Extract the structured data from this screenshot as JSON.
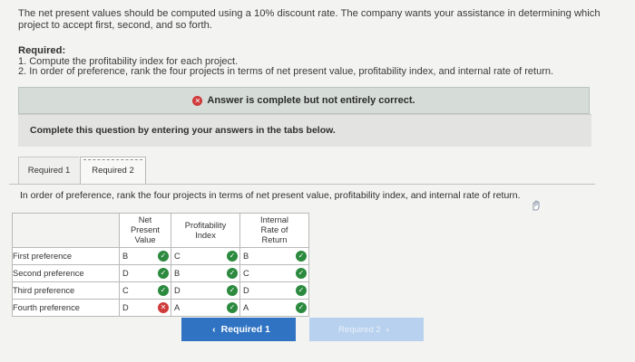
{
  "intro": {
    "line1": "The net present values should be computed using a 10% discount rate. The company wants your assistance in determining which",
    "line2": "project to accept first, second, and so forth."
  },
  "required": {
    "title": "Required:",
    "items": [
      "1. Compute the profitability index for each project.",
      "2. In order of preference, rank the four projects in terms of net present value, profitability index, and internal rate of return."
    ]
  },
  "answer_banner": {
    "status_icon": "x-circle-icon",
    "text": "Answer is complete but not entirely correct."
  },
  "instruction": "Complete this question by entering your answers in the tabs below.",
  "tabs": [
    {
      "label": "Required 1"
    },
    {
      "label": "Required 2"
    }
  ],
  "question": "In order of preference, rank the four projects in terms of net present value, profitability index, and internal rate of return.",
  "table": {
    "headers": {
      "npv": [
        "Net",
        "Present",
        "Value"
      ],
      "pi": [
        "Profitability",
        "Index"
      ],
      "irr": [
        "Internal",
        "Rate of",
        "Return"
      ]
    },
    "rows": [
      {
        "label": "First preference",
        "npv": "B",
        "npv_ok": true,
        "pi": "C",
        "pi_ok": true,
        "irr": "B",
        "irr_ok": true
      },
      {
        "label": "Second preference",
        "npv": "D",
        "npv_ok": true,
        "pi": "B",
        "pi_ok": true,
        "irr": "C",
        "irr_ok": true
      },
      {
        "label": "Third preference",
        "npv": "C",
        "npv_ok": true,
        "pi": "D",
        "pi_ok": true,
        "irr": "D",
        "irr_ok": true
      },
      {
        "label": "Fourth preference",
        "npv": "D",
        "npv_ok": false,
        "pi": "A",
        "pi_ok": true,
        "irr": "A",
        "irr_ok": true
      }
    ]
  },
  "nav": {
    "prev_label": "Required 1",
    "next_label": "Required 2"
  },
  "colors": {
    "primary_button": "#2f73c2",
    "disabled_button": "#b8d1ee",
    "correct": "#2b8a3e",
    "incorrect": "#cf3a3a",
    "banner": "#d6ddd9"
  }
}
